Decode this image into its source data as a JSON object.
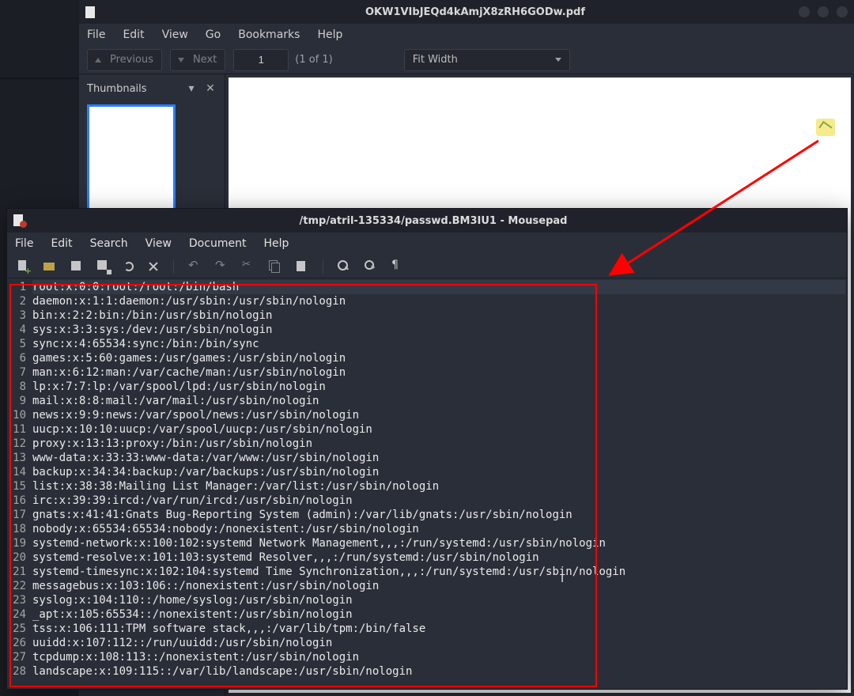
{
  "pdf": {
    "title": "OKW1VIbJEQd4kAmjX8zRH6GODw.pdf",
    "menu": [
      "File",
      "Edit",
      "View",
      "Go",
      "Bookmarks",
      "Help"
    ],
    "nav": {
      "prev": "Previous",
      "next": "Next"
    },
    "page_input": "1",
    "page_of": "(1 of 1)",
    "zoom": "Fit Width",
    "side_label": "Thumbnails"
  },
  "editor": {
    "title": "/tmp/atril-135334/passwd.BM3IU1 - Mousepad",
    "menu": [
      "File",
      "Edit",
      "Search",
      "View",
      "Document",
      "Help"
    ],
    "toolbar_icons": [
      "new",
      "open",
      "save",
      "saveas",
      "reload",
      "close",
      "|",
      "undo",
      "redo",
      "cut",
      "copy",
      "paste",
      "|",
      "find",
      "replace",
      "goto"
    ],
    "lines": [
      "root:x:0:0:root:/root:/bin/bash",
      "daemon:x:1:1:daemon:/usr/sbin:/usr/sbin/nologin",
      "bin:x:2:2:bin:/bin:/usr/sbin/nologin",
      "sys:x:3:3:sys:/dev:/usr/sbin/nologin",
      "sync:x:4:65534:sync:/bin:/bin/sync",
      "games:x:5:60:games:/usr/games:/usr/sbin/nologin",
      "man:x:6:12:man:/var/cache/man:/usr/sbin/nologin",
      "lp:x:7:7:lp:/var/spool/lpd:/usr/sbin/nologin",
      "mail:x:8:8:mail:/var/mail:/usr/sbin/nologin",
      "news:x:9:9:news:/var/spool/news:/usr/sbin/nologin",
      "uucp:x:10:10:uucp:/var/spool/uucp:/usr/sbin/nologin",
      "proxy:x:13:13:proxy:/bin:/usr/sbin/nologin",
      "www-data:x:33:33:www-data:/var/www:/usr/sbin/nologin",
      "backup:x:34:34:backup:/var/backups:/usr/sbin/nologin",
      "list:x:38:38:Mailing List Manager:/var/list:/usr/sbin/nologin",
      "irc:x:39:39:ircd:/var/run/ircd:/usr/sbin/nologin",
      "gnats:x:41:41:Gnats Bug-Reporting System (admin):/var/lib/gnats:/usr/sbin/nologin",
      "nobody:x:65534:65534:nobody:/nonexistent:/usr/sbin/nologin",
      "systemd-network:x:100:102:systemd Network Management,,,:/run/systemd:/usr/sbin/nologin",
      "systemd-resolve:x:101:103:systemd Resolver,,,:/run/systemd:/usr/sbin/nologin",
      "systemd-timesync:x:102:104:systemd Time Synchronization,,,:/run/systemd:/usr/sbin/nologin",
      "messagebus:x:103:106::/nonexistent:/usr/sbin/nologin",
      "syslog:x:104:110::/home/syslog:/usr/sbin/nologin",
      "_apt:x:105:65534::/nonexistent:/usr/sbin/nologin",
      "tss:x:106:111:TPM software stack,,,:/var/lib/tpm:/bin/false",
      "uuidd:x:107:112::/run/uuidd:/usr/sbin/nologin",
      "tcpdump:x:108:113::/nonexistent:/usr/sbin/nologin",
      "landscape:x:109:115::/var/lib/landscape:/usr/sbin/nologin"
    ]
  }
}
